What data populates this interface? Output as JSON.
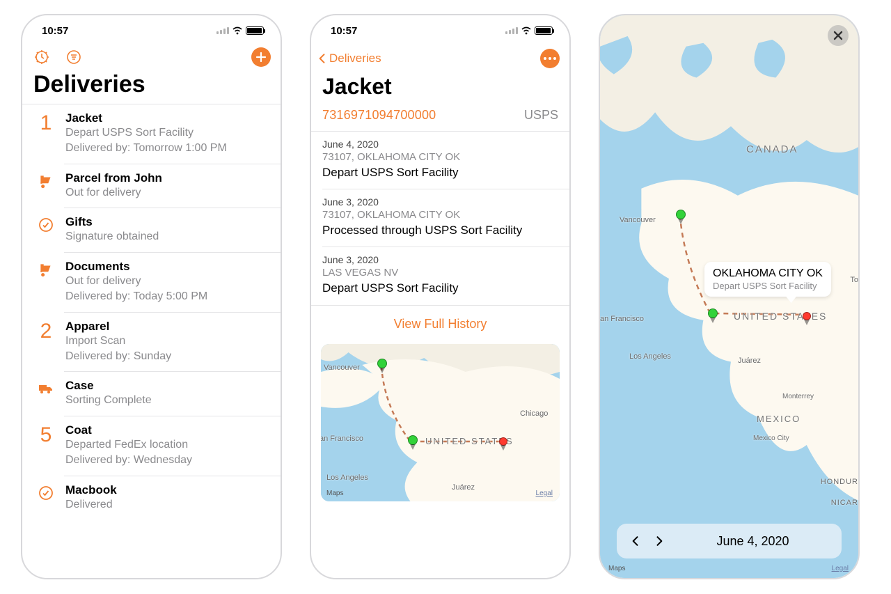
{
  "accent": "#f27e30",
  "status": {
    "time": "10:57"
  },
  "screen1": {
    "title": "Deliveries",
    "items": [
      {
        "icon": "num",
        "iconVal": "1",
        "title": "Jacket",
        "sub1": "Depart USPS Sort Facility",
        "sub2": "Delivered by: Tomorrow 1:00 PM"
      },
      {
        "icon": "dolly",
        "title": "Parcel from John",
        "sub1": "Out for delivery"
      },
      {
        "icon": "check",
        "title": "Gifts",
        "sub1": "Signature obtained"
      },
      {
        "icon": "dolly",
        "title": "Documents",
        "sub1": "Out for delivery",
        "sub2": "Delivered by: Today 5:00 PM"
      },
      {
        "icon": "num",
        "iconVal": "2",
        "title": "Apparel",
        "sub1": "Import Scan",
        "sub2": "Delivered by: Sunday"
      },
      {
        "icon": "truck",
        "title": "Case",
        "sub1": "Sorting Complete"
      },
      {
        "icon": "num",
        "iconVal": "5",
        "title": "Coat",
        "sub1": "Departed FedEx location",
        "sub2": "Delivered by: Wednesday"
      },
      {
        "icon": "check",
        "title": "Macbook",
        "sub1": "Delivered"
      }
    ]
  },
  "screen2": {
    "backLabel": "Deliveries",
    "title": "Jacket",
    "tracking": "7316971094700000",
    "carrier": "USPS",
    "events": [
      {
        "date": "June 4, 2020",
        "loc": "73107, OKLAHOMA CITY OK",
        "status": "Depart USPS Sort Facility"
      },
      {
        "date": "June 3, 2020",
        "loc": "73107, OKLAHOMA CITY OK",
        "status": "Processed through USPS Sort Facility"
      },
      {
        "date": "June 3, 2020",
        "loc": "LAS VEGAS NV",
        "status": "Depart USPS Sort Facility"
      }
    ],
    "viewHistory": "View Full History",
    "mapLabels": {
      "vancouver": "Vancouver",
      "sf": "an Francisco",
      "la": "Los Angeles",
      "us": "UNITED STATES",
      "chicago": "Chicago",
      "juarez": "Juárez"
    },
    "mapsAttribution": "Maps",
    "legal": "Legal"
  },
  "screen3": {
    "callout": {
      "title": "OKLAHOMA CITY OK",
      "sub": "Depart USPS Sort Facility"
    },
    "date": "June 4, 2020",
    "labels": {
      "canada": "CANADA",
      "vancouver": "Vancouver",
      "sf": "an Francisco",
      "la": "Los Angeles",
      "us": "UNITED  STATES",
      "to": "To",
      "juarez": "Juárez",
      "monterrey": "Monterrey",
      "mexico": "MEXICO",
      "mexcity": "Mexico City",
      "hondur": "HONDUR",
      "nicar": "NICAR"
    },
    "mapsAttribution": "Maps",
    "legal": "Legal"
  }
}
